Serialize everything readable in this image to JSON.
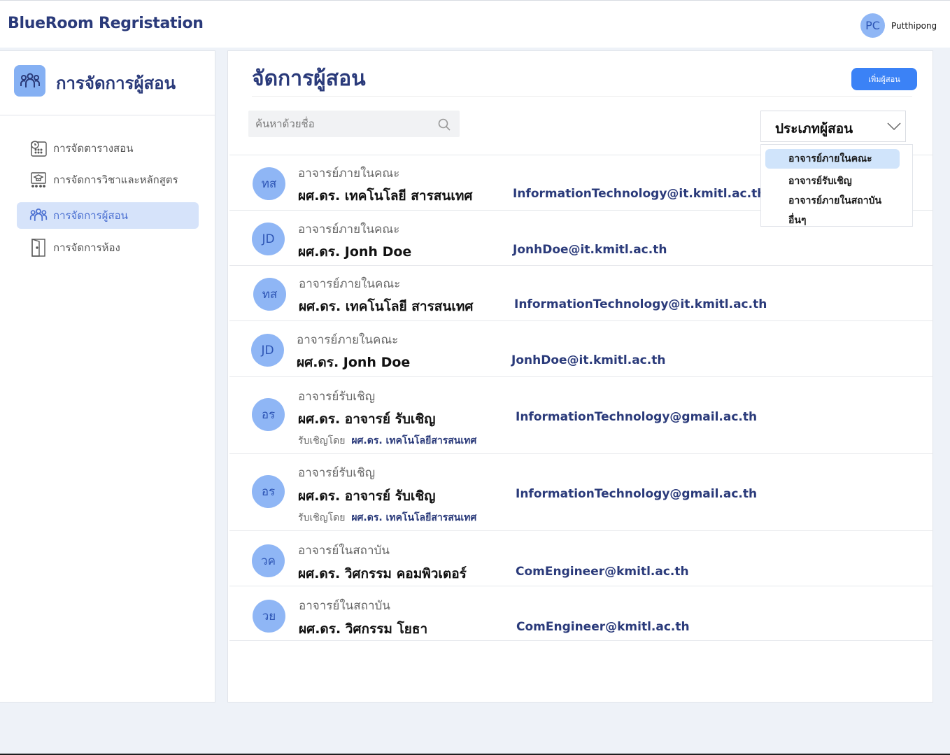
{
  "app": {
    "brand": "BlueRoom Regristation"
  },
  "user": {
    "initials": "PC",
    "name": "Putthipong"
  },
  "sidebar": {
    "title": "การจัดการผู้สอน",
    "items": [
      {
        "label": "การจัดตารางสอน",
        "icon": "schedule-icon"
      },
      {
        "label": "การจัดการวิชาและหลักสูตร",
        "icon": "course-board-icon"
      },
      {
        "label": "การจัดการผู้สอน",
        "icon": "people-group-icon",
        "active": true
      },
      {
        "label": "การจัดการห้อง",
        "icon": "door-icon"
      }
    ]
  },
  "main": {
    "title": "จัดการผู้สอน",
    "add_button": "เพิ่มผู้สอน",
    "search_placeholder": "ค้นหาด้วยชื่อ",
    "filter": {
      "label": "ประเภทผู้สอน",
      "options": [
        "อาจารย์ภายในคณะ",
        "อาจารย์รับเชิญ",
        "อาจารย์ภายในสถาบัน",
        "อื่นๆ"
      ],
      "highlighted": "อาจารย์ภายในคณะ"
    },
    "rows": [
      {
        "initials": "ทส",
        "type": "อาจารย์ภายในคณะ",
        "name": "ผศ.ดร. เทคโนโลยี สารสนเทศ",
        "email": "InformationTechnology@it.kmitl.ac.th"
      },
      {
        "initials": "JD",
        "type": "อาจารย์ภายในคณะ",
        "name": "ผศ.ดร. Jonh Doe",
        "email": "JonhDoe@it.kmitl.ac.th"
      },
      {
        "initials": "ทส",
        "type": "อาจารย์ภายในคณะ",
        "name": "ผศ.ดร. เทคโนโลยี สารสนเทศ",
        "email": "InformationTechnology@it.kmitl.ac.th"
      },
      {
        "initials": "JD",
        "type": "อาจารย์ภายในคณะ",
        "name": "ผศ.ดร. Jonh Doe",
        "email": "JonhDoe@it.kmitl.ac.th"
      },
      {
        "initials": "อร",
        "type": "อาจารย์รับเชิญ",
        "name": "ผศ.ดร. อาจารย์  รับเชิญ",
        "email": "InformationTechnology@gmail.ac.th",
        "invited_by_label": "รับเชิญโดย",
        "invited_by": "ผศ.ดร. เทคโนโลยีสารสนเทศ"
      },
      {
        "initials": "อร",
        "type": "อาจารย์รับเชิญ",
        "name": "ผศ.ดร. อาจารย์  รับเชิญ",
        "email": "InformationTechnology@gmail.ac.th",
        "invited_by_label": "รับเชิญโดย",
        "invited_by": "ผศ.ดร. เทคโนโลยีสารสนเทศ"
      },
      {
        "initials": "วค",
        "type": "อาจารย์ในสถาบัน",
        "name": "ผศ.ดร. วิศกรรม คอมพิวเตอร์",
        "email": "ComEngineer@kmitl.ac.th"
      },
      {
        "initials": "วย",
        "type": "อาจารย์ในสถาบัน",
        "name": "ผศ.ดร. วิศกรรม โยธา",
        "email": "ComEngineer@kmitl.ac.th"
      }
    ]
  },
  "colors": {
    "brand": "#2a3a7a",
    "accent": "#3b82f6",
    "avatar_bg": "#8fb6f5",
    "active_nav": "#d6e3fa"
  }
}
